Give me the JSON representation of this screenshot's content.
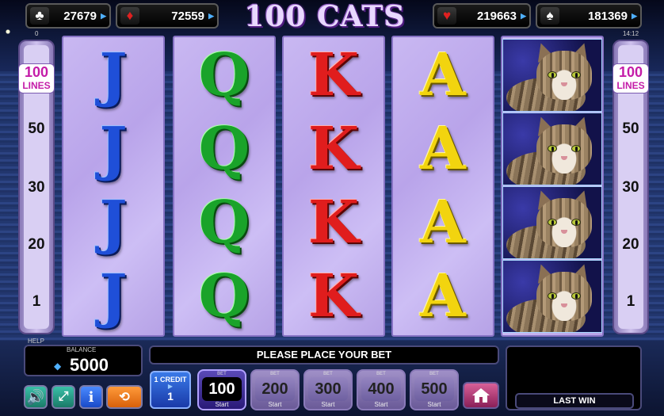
{
  "title": "100 CATS",
  "jackpots": [
    {
      "suit": "♣",
      "value": "27679",
      "color": "#ffffff"
    },
    {
      "suit": "♦",
      "value": "72559",
      "color": "#e02020"
    },
    {
      "suit": "♥",
      "value": "219663",
      "color": "#e02020"
    },
    {
      "suit": "♠",
      "value": "181369",
      "color": "#ffffff"
    }
  ],
  "clock": "14:12",
  "corner_zero": "0",
  "lines_panel": {
    "top_number": "100",
    "top_label": "LINES",
    "numbers": [
      "50",
      "30",
      "20",
      "1"
    ]
  },
  "reels": [
    [
      "J",
      "J",
      "J",
      "J"
    ],
    [
      "Q",
      "Q",
      "Q",
      "Q"
    ],
    [
      "K",
      "K",
      "K",
      "K"
    ],
    [
      "A",
      "A",
      "A",
      "A"
    ],
    [
      "cat",
      "cat",
      "cat",
      "cat"
    ]
  ],
  "help_label": "HELP",
  "balance": {
    "label": "BALANCE",
    "value": "5000"
  },
  "message": "PLEASE PLACE YOUR BET",
  "last_win_label": "LAST WIN",
  "credit": {
    "label": "1 CREDIT",
    "value": "1"
  },
  "bets": [
    {
      "label": "BET",
      "value": "100",
      "start": "Start",
      "active": true
    },
    {
      "label": "BET",
      "value": "200",
      "start": "Start",
      "active": false
    },
    {
      "label": "BET",
      "value": "300",
      "start": "Start",
      "active": false
    },
    {
      "label": "BET",
      "value": "400",
      "start": "Start",
      "active": false
    },
    {
      "label": "BET",
      "value": "500",
      "start": "Start",
      "active": false
    }
  ],
  "icons": {
    "sound": "speaker-icon",
    "fullscreen": "fullscreen-icon",
    "info": "info-icon",
    "autoplay": "autoplay-icon",
    "home": "home-icon"
  },
  "colors": {
    "accent_lines": "#c41ca8",
    "reel_bg": "#c3b1f0",
    "info_btn": "#2a6ae8",
    "autoplay_btn": "#e8701a",
    "sound_btn": "#2aa08a"
  }
}
